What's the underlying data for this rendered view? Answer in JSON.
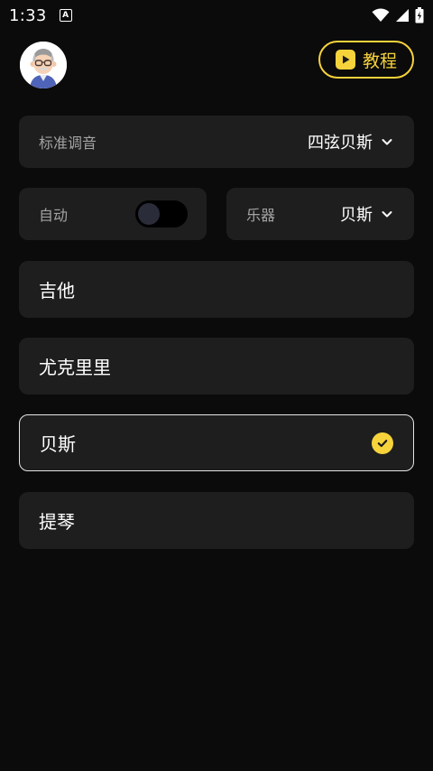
{
  "status_bar": {
    "time": "1:33",
    "notification_letter": "A"
  },
  "header": {
    "tutorial_label": "教程"
  },
  "tuning": {
    "label": "标准调音",
    "value": "四弦贝斯"
  },
  "auto": {
    "label": "自动",
    "enabled": false
  },
  "instrument": {
    "label": "乐器",
    "value": "贝斯"
  },
  "options": [
    {
      "label": "吉他",
      "selected": false
    },
    {
      "label": "尤克里里",
      "selected": false
    },
    {
      "label": "贝斯",
      "selected": true
    },
    {
      "label": "提琴",
      "selected": false
    }
  ],
  "colors": {
    "accent": "#f6d33b",
    "background": "#0b0b0b",
    "card": "#1e1e1e",
    "muted_text": "#a3a3a3"
  },
  "icons": [
    "notification-icon",
    "wifi-icon",
    "signal-icon",
    "battery-icon",
    "play-icon",
    "chevron-down-icon",
    "check-icon"
  ]
}
